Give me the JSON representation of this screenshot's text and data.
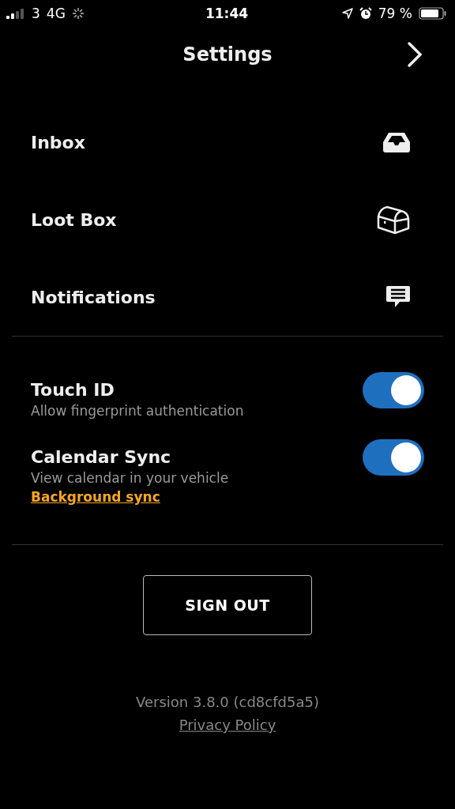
{
  "status_bar": {
    "carrier": "3",
    "network": "4G",
    "time": "11:44",
    "battery": "79 %"
  },
  "header": {
    "title": "Settings"
  },
  "menu": [
    {
      "label": "Inbox",
      "kind": "inbox"
    },
    {
      "label": "Loot Box",
      "kind": "chest"
    },
    {
      "label": "Notifications",
      "kind": "message"
    }
  ],
  "toggles": [
    {
      "title": "Touch ID",
      "subtitle": "Allow fingerprint authentication",
      "on": true
    },
    {
      "title": "Calendar Sync",
      "subtitle": "View calendar in your vehicle",
      "link": "Background sync",
      "on": true
    }
  ],
  "sign_out": "SIGN OUT",
  "footer": {
    "version": "Version 3.8.0 (cd8cfd5a5)",
    "link": "Privacy Policy"
  }
}
